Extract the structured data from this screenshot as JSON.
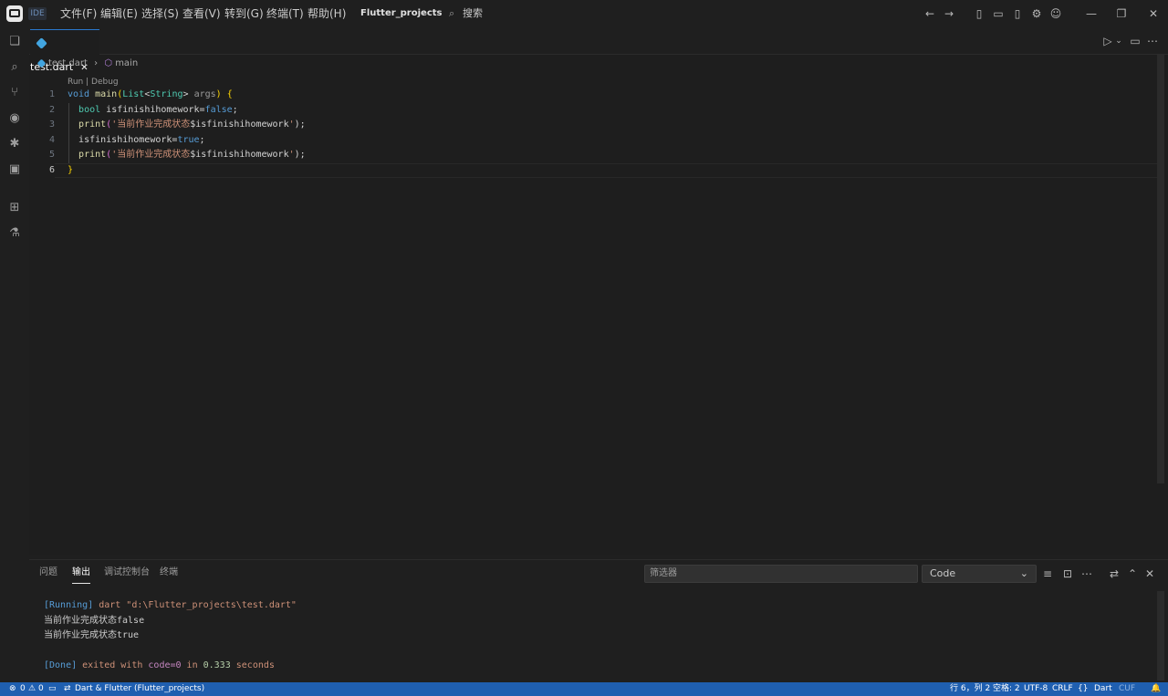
{
  "titlebar": {
    "ide_label": "IDE",
    "menus": [
      "文件(F)",
      "编辑(E)",
      "选择(S)",
      "查看(V)",
      "转到(G)",
      "终端(T)",
      "帮助(H)"
    ],
    "project": "Flutter_projects",
    "search_placeholder": "搜索"
  },
  "tab": {
    "label": "test.dart"
  },
  "breadcrumb": {
    "file": "test.dart",
    "symbol": "main"
  },
  "codelens": "Run | Debug",
  "line_numbers": [
    "1",
    "2",
    "3",
    "4",
    "5",
    "6"
  ],
  "code": {
    "l1": {
      "kw": "void",
      "fn": "main",
      "p1": "(",
      "ty1": "List",
      "lt": "<",
      "ty2": "String",
      "gt": ">",
      "arg": "args",
      "p2": ")",
      "sp": " ",
      "br": "{"
    },
    "l2": {
      "ty": "bool",
      "id": "isfinishihomework",
      "op": "=",
      "kw": "false",
      "semi": ";"
    },
    "l3": {
      "fn": "print",
      "p1": "(",
      "str": "'当前作业完成状态",
      "var": "$isfinishihomework",
      "end": "'",
      "p2": ");"
    },
    "l4": {
      "id": "isfinishihomework",
      "op": "=",
      "kw": "true",
      "semi": ";"
    },
    "l5": {
      "fn": "print",
      "p1": "(",
      "str": "'当前作业完成状态",
      "var": "$isfinishihomework",
      "end": "'",
      "p2": ");"
    },
    "l6": {
      "br": "}"
    }
  },
  "panel": {
    "tabs": [
      "问题",
      "输出",
      "调试控制台",
      "终端"
    ],
    "active_tab": "输出",
    "filter_placeholder": "筛选器",
    "select_value": "Code",
    "output": {
      "running_tag": "[Running]",
      "running_cmd": " dart \"d:\\Flutter_projects\\test.dart\"",
      "line2": "当前作业完成状态false",
      "line3": "当前作业完成状态true",
      "done_tag": "[Done]",
      "done_text": " exited with ",
      "done_code": "code=0",
      "done_in": " in ",
      "done_secs": "0.333",
      "done_unit": " seconds"
    }
  },
  "statusbar": {
    "errors": "0",
    "warnings": "0",
    "project": "Dart & Flutter (Flutter_projects)",
    "position": "行 6，列 2",
    "spaces": "空格: 2",
    "encoding": "UTF-8",
    "eol": "CRLF",
    "braces": "{}",
    "language": "Dart",
    "copilot": "CUF"
  },
  "colors": {
    "accent": "#2b79d0",
    "statusbar": "#1f5fb0",
    "background": "#1f1f1f"
  }
}
